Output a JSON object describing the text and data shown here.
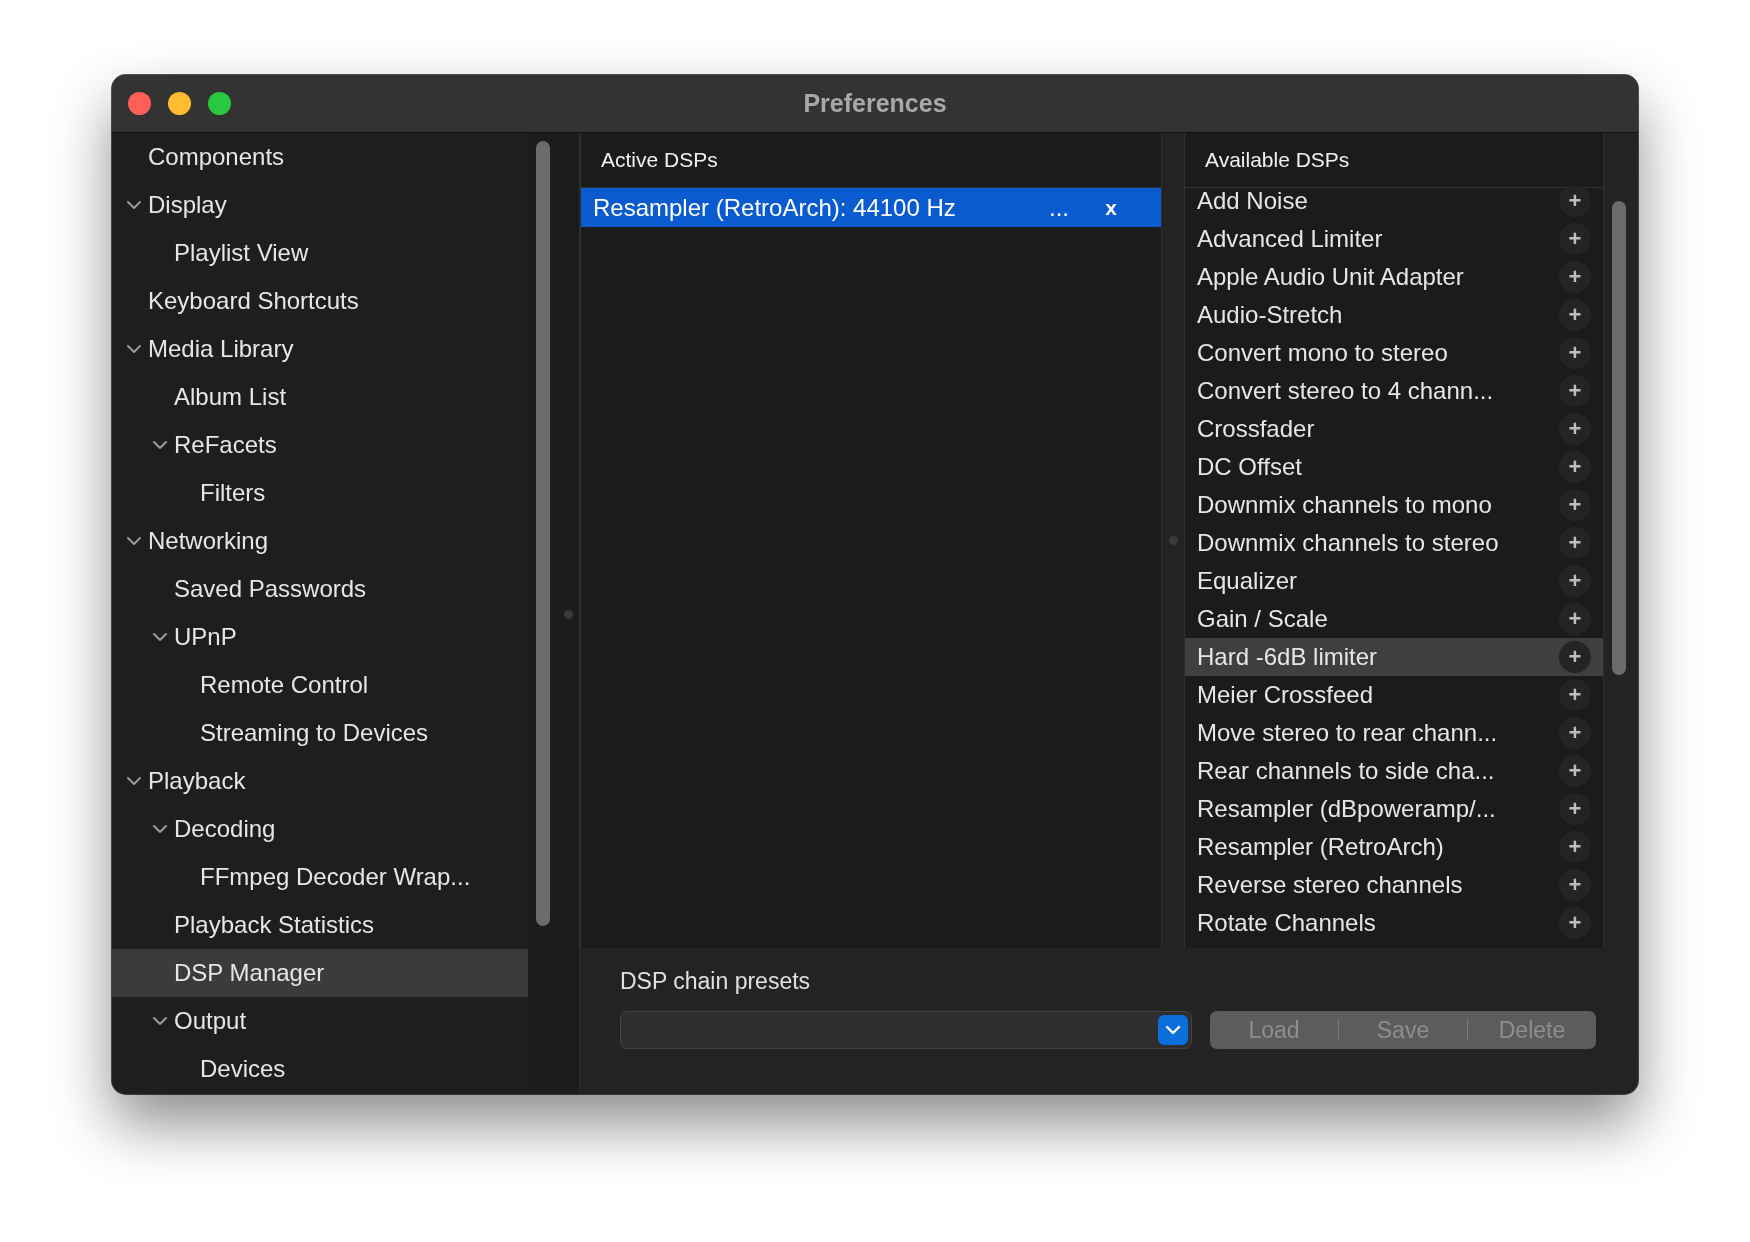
{
  "window": {
    "title": "Preferences"
  },
  "sidebar": {
    "items": [
      {
        "label": "Components",
        "selected": false
      },
      {
        "label": "Display",
        "selected": false,
        "expanded": true,
        "children": [
          {
            "label": "Playlist View",
            "selected": false
          }
        ]
      },
      {
        "label": "Keyboard Shortcuts",
        "selected": false
      },
      {
        "label": "Media Library",
        "selected": false,
        "expanded": true,
        "children": [
          {
            "label": "Album List",
            "selected": false
          },
          {
            "label": "ReFacets",
            "selected": false,
            "expanded": true,
            "children": [
              {
                "label": "Filters",
                "selected": false
              }
            ]
          }
        ]
      },
      {
        "label": "Networking",
        "selected": false,
        "expanded": true,
        "children": [
          {
            "label": "Saved Passwords",
            "selected": false
          },
          {
            "label": "UPnP",
            "selected": false,
            "expanded": true,
            "children": [
              {
                "label": "Remote Control",
                "selected": false
              },
              {
                "label": "Streaming to Devices",
                "selected": false
              }
            ]
          }
        ]
      },
      {
        "label": "Playback",
        "selected": false,
        "expanded": true,
        "children": [
          {
            "label": "Decoding",
            "selected": false,
            "expanded": true,
            "children": [
              {
                "label": "FFmpeg Decoder Wrap...",
                "selected": false
              }
            ]
          },
          {
            "label": "Playback Statistics",
            "selected": false
          },
          {
            "label": "DSP Manager",
            "selected": true
          },
          {
            "label": "Output",
            "selected": false,
            "expanded": true,
            "children": [
              {
                "label": "Devices",
                "selected": false
              }
            ]
          }
        ]
      }
    ]
  },
  "active_dsps": {
    "header": "Active DSPs",
    "rows": [
      {
        "name": "Resampler (RetroArch): 44100 Hz",
        "configure": "...",
        "remove": "x",
        "selected": true
      }
    ]
  },
  "available_dsps": {
    "header": "Available DSPs",
    "rows": [
      {
        "name": "Add Noise",
        "add": "+",
        "selected": false
      },
      {
        "name": "Advanced Limiter",
        "add": "+",
        "selected": false
      },
      {
        "name": "Apple Audio Unit Adapter",
        "add": "+",
        "selected": false
      },
      {
        "name": "Audio-Stretch",
        "add": "+",
        "selected": false
      },
      {
        "name": "Convert mono to stereo",
        "add": "+",
        "selected": false
      },
      {
        "name": "Convert stereo to 4 chann...",
        "add": "+",
        "selected": false
      },
      {
        "name": "Crossfader",
        "add": "+",
        "selected": false
      },
      {
        "name": "DC Offset",
        "add": "+",
        "selected": false
      },
      {
        "name": "Downmix channels to mono",
        "add": "+",
        "selected": false
      },
      {
        "name": "Downmix channels to stereo",
        "add": "+",
        "selected": false
      },
      {
        "name": "Equalizer",
        "add": "+",
        "selected": false
      },
      {
        "name": "Gain / Scale",
        "add": "+",
        "selected": false
      },
      {
        "name": "Hard -6dB limiter",
        "add": "+",
        "selected": true
      },
      {
        "name": "Meier Crossfeed",
        "add": "+",
        "selected": false
      },
      {
        "name": "Move stereo to rear chann...",
        "add": "+",
        "selected": false
      },
      {
        "name": "Rear channels to side cha...",
        "add": "+",
        "selected": false
      },
      {
        "name": "Resampler (dBpoweramp/...",
        "add": "+",
        "selected": false
      },
      {
        "name": "Resampler (RetroArch)",
        "add": "+",
        "selected": false
      },
      {
        "name": "Reverse stereo channels",
        "add": "+",
        "selected": false
      },
      {
        "name": "Rotate Channels",
        "add": "+",
        "selected": false
      }
    ]
  },
  "presets": {
    "label": "DSP chain presets",
    "buttons": [
      {
        "label": "Load",
        "disabled": true
      },
      {
        "label": "Save",
        "disabled": true
      },
      {
        "label": "Delete",
        "disabled": true
      }
    ]
  }
}
